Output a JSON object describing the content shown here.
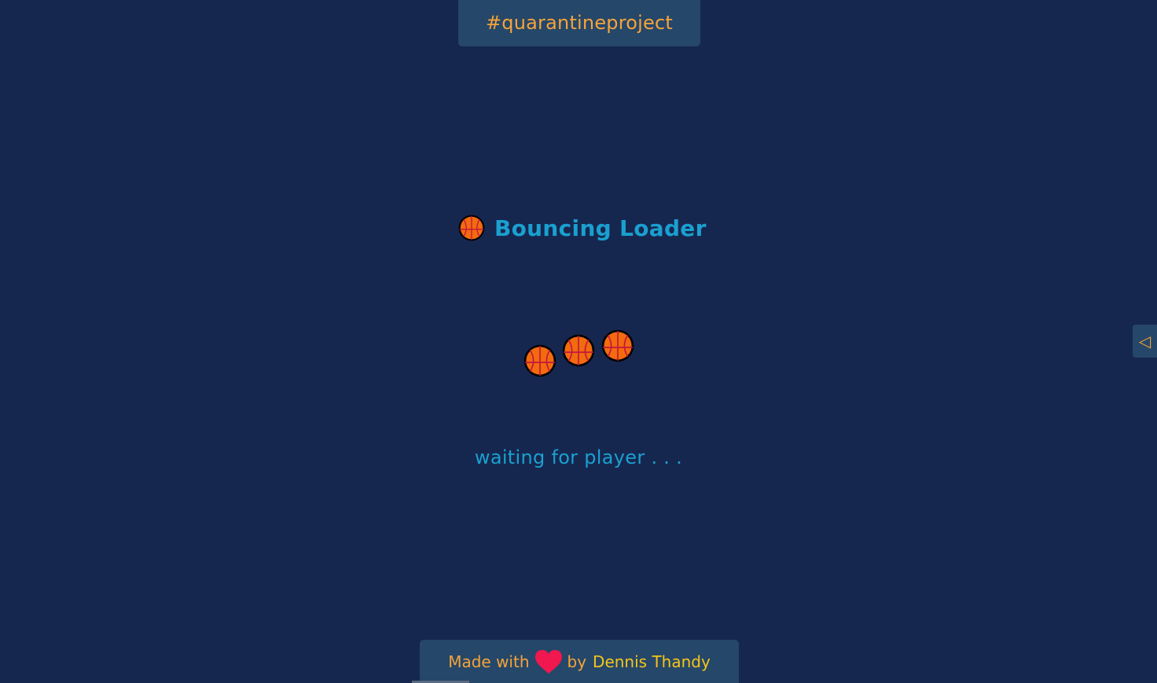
{
  "header": {
    "badge_text": "#quarantineproject"
  },
  "main": {
    "title_icon": "basketball-icon",
    "title": "Bouncing Loader",
    "loader_icon": "basketball-icon",
    "status_text": "waiting for player . . ."
  },
  "side_panel": {
    "toggle_icon": "triangle-left-icon",
    "toggle_glyph": "◁"
  },
  "footer": {
    "made_with": "Made with",
    "heart_icon": "heart-icon",
    "by": "by",
    "author": "Dennis Thandy"
  },
  "colors": {
    "background": "#16274f",
    "panel": "#254769",
    "accent_orange": "#f5a33a",
    "accent_blue": "#1aa0d0",
    "author_yellow": "#f5c518",
    "heart": "#f0184e",
    "ball_orange": "#f26b0f",
    "ball_lines": "#c5173d"
  }
}
